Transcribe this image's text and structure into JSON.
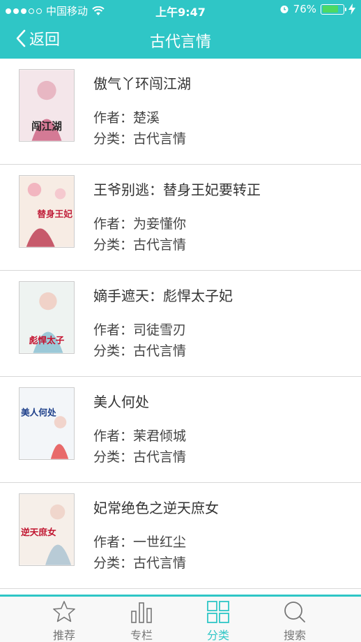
{
  "status_bar": {
    "carrier": "中国移动",
    "time": "上午9:47",
    "battery_percent": "76%",
    "battery_level": 0.76
  },
  "nav": {
    "back_label": "返回",
    "title": "古代言情"
  },
  "books": [
    {
      "title": "傲气丫环闯江湖",
      "author": "作者：楚溪",
      "category": "分类：古代言情",
      "cover_text": "闯江湖"
    },
    {
      "title": "王爷别逃：替身王妃要转正",
      "author": "作者：为妾懂你",
      "category": "分类：古代言情",
      "cover_text": "替身王妃"
    },
    {
      "title": "嫡手遮天：彪悍太子妃",
      "author": "作者：司徒雪刃",
      "category": "分类：古代言情",
      "cover_text": "彪悍太子"
    },
    {
      "title": "美人何处",
      "author": "作者：茉君倾城",
      "category": "分类：古代言情",
      "cover_text": "美人何处"
    },
    {
      "title": "妃常绝色之逆天庶女",
      "author": "作者：一世红尘",
      "category": "分类：古代言情",
      "cover_text": "逆天庶女"
    }
  ],
  "tabs": [
    {
      "label": "推荐",
      "icon": "star-icon",
      "active": false
    },
    {
      "label": "专栏",
      "icon": "bar-chart-icon",
      "active": false
    },
    {
      "label": "分类",
      "icon": "grid-icon",
      "active": true
    },
    {
      "label": "搜索",
      "icon": "search-icon",
      "active": false
    }
  ],
  "colors": {
    "accent": "#2fc6c6",
    "battery": "#4cd964",
    "tab_inactive": "#777777"
  }
}
